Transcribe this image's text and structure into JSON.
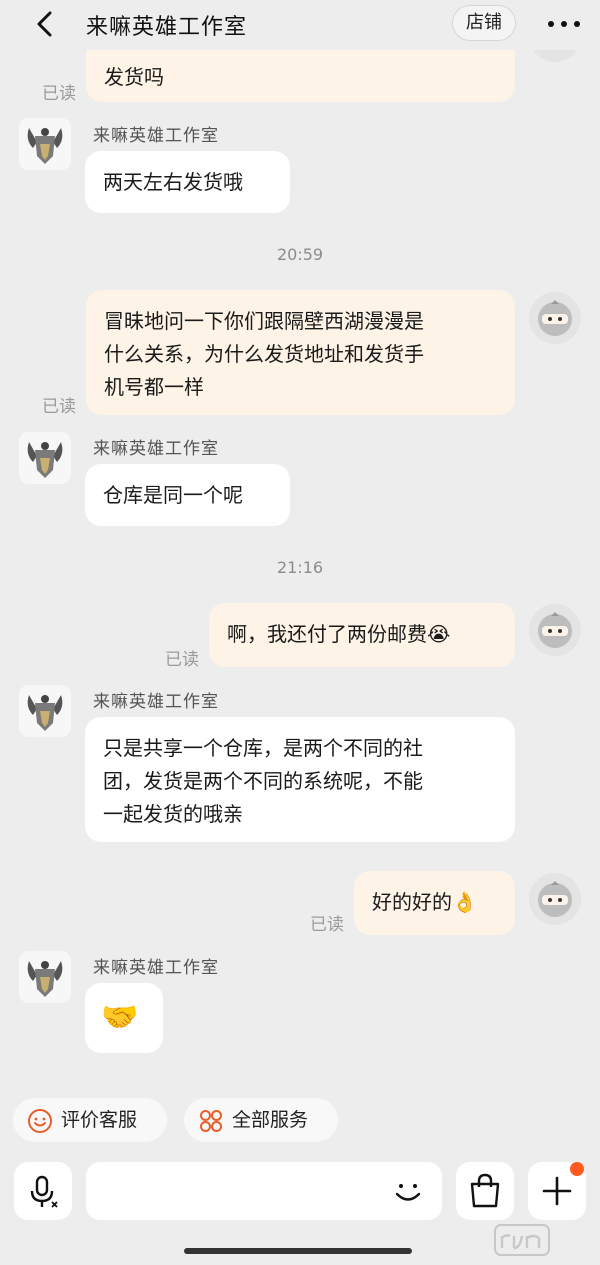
{
  "header": {
    "title": "来嘛英雄工作室",
    "shop_label": "店铺"
  },
  "messages": [
    {
      "id": "m0",
      "side": "mine",
      "text": "发货吗",
      "read": "已读"
    },
    {
      "id": "m1",
      "side": "theirs",
      "sender": "来嘛英雄工作室",
      "text": "两天左右发货哦"
    },
    {
      "id": "t1",
      "time": "20:59"
    },
    {
      "id": "m2",
      "side": "mine",
      "lines": [
        "冒昧地问一下你们跟隔壁西湖漫漫是",
        "什么关系，为什么发货地址和发货手",
        "机号都一样"
      ],
      "read": "已读"
    },
    {
      "id": "m3",
      "side": "theirs",
      "sender": "来嘛英雄工作室",
      "text": "仓库是同一个呢"
    },
    {
      "id": "t2",
      "time": "21:16"
    },
    {
      "id": "m4",
      "side": "mine",
      "text": "啊，我还付了两份邮费😭",
      "read": "已读"
    },
    {
      "id": "m5",
      "side": "theirs",
      "sender": "来嘛英雄工作室",
      "lines": [
        "只是共享一个仓库，是两个不同的社",
        "团，发货是两个不同的系统呢，不能",
        "一起发货的哦亲"
      ]
    },
    {
      "id": "m6",
      "side": "mine",
      "text": "好的好的👌",
      "read": "已读"
    },
    {
      "id": "m7",
      "side": "theirs",
      "sender": "来嘛英雄工作室",
      "emoji": "🤝"
    }
  ],
  "quick_actions": [
    {
      "label": "评价客服",
      "icon": "smile-face-icon"
    },
    {
      "label": "全部服务",
      "icon": "grid-services-icon"
    }
  ],
  "input_bar": {
    "voice_icon": "microphone-icon",
    "emoji_icon": "emoji-face-icon",
    "shop_icon": "shopping-bag-icon",
    "add_icon": "plus-icon",
    "placeholder": ""
  },
  "colors": {
    "background": "#ededed",
    "mine_bubble": "#fdf4e7",
    "theirs_bubble": "#ffffff",
    "accent": "#ff5a1f",
    "read_text": "#9a9a9a"
  }
}
